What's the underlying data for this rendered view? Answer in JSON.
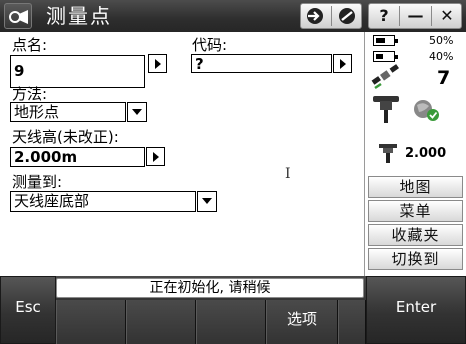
{
  "window": {
    "title": "测量点",
    "controls": [
      "?",
      "—",
      "✕"
    ]
  },
  "form": {
    "point_name_label": "点名:",
    "point_name_value": "9",
    "code_label": "代码:",
    "code_value": "?",
    "method_label": "方法:",
    "method_value": "地形点",
    "antenna_height_label": "天线高(未改正):",
    "antenna_height_value": "2.000m",
    "measure_to_label": "测量到:",
    "measure_to_value": "天线座底部"
  },
  "status_panel": {
    "battery_1_percent": "50%",
    "battery_2_percent": "40%",
    "satellites": "7",
    "antenna_height": "2.000",
    "buttons": [
      "地图",
      "菜单",
      "收藏夹",
      "切换到"
    ]
  },
  "bottom": {
    "status_message": "正在初始化, 请稍候",
    "esc_label": "Esc",
    "options_label": "选项",
    "enter_label": "Enter"
  },
  "colors": {
    "accent_green": "#3a9a3a",
    "title_bar": "#333333"
  },
  "icons": {
    "app": "survey-instrument-icon",
    "tool_a": "connect-arrow-icon",
    "tool_b": "no-entry-icon"
  }
}
